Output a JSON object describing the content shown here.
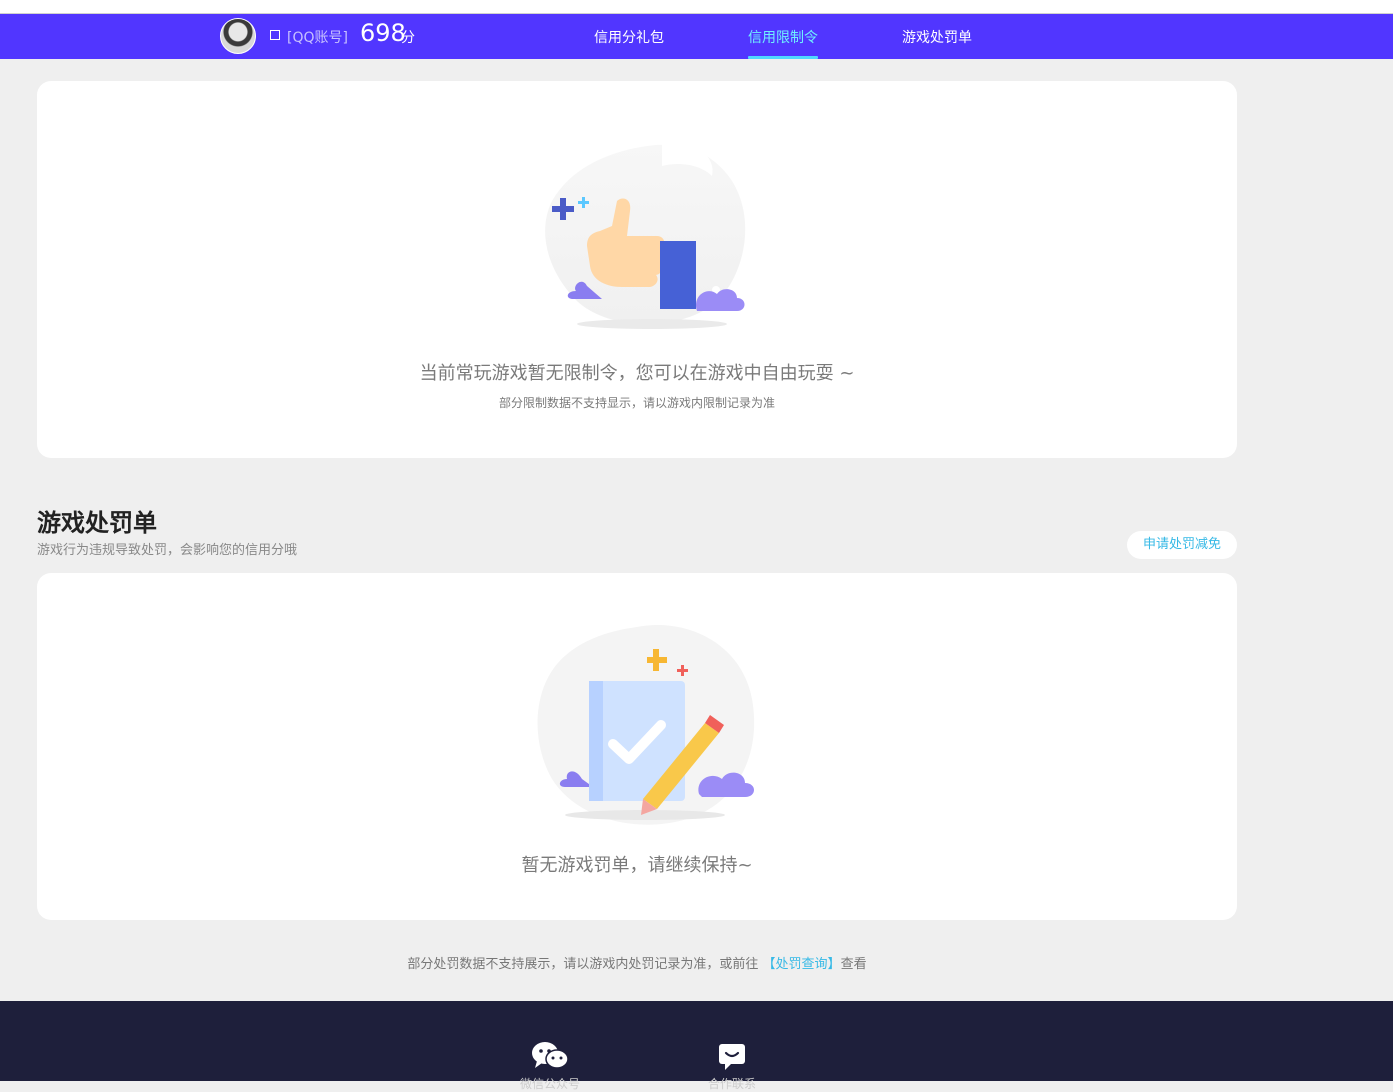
{
  "header": {
    "account_type": "[QQ账号]",
    "score": "698",
    "score_unit": "分",
    "tabs": [
      {
        "label": "信用分礼包",
        "active": false
      },
      {
        "label": "信用限制令",
        "active": true
      },
      {
        "label": "游戏处罚单",
        "active": false
      }
    ]
  },
  "restriction_section": {
    "empty_title": "当前常玩游戏暂无限制令，您可以在游戏中自由玩耍 ~",
    "empty_note": "部分限制数据不支持显示，请以游戏内限制记录为准"
  },
  "penalty_section": {
    "title": "游戏处罚单",
    "description": "游戏行为违规导致处罚，会影响您的信用分哦",
    "appeal_button": "申请处罚减免",
    "empty_title": "暂无游戏罚单，请继续保持~"
  },
  "footnote": {
    "text_before": "部分处罚数据不支持展示，请以游戏内处罚记录为准，或前往 ",
    "link_text": "【处罚查询】",
    "text_after": "查看"
  },
  "footer": {
    "items": [
      {
        "label": "微信公众号",
        "icon": "wechat-icon"
      },
      {
        "label": "合作联系",
        "icon": "message-icon"
      }
    ]
  },
  "colors": {
    "nav_bg": "#5136ff",
    "active_tab": "#6ff0ff",
    "link": "#36b9e6",
    "footer_bg": "#1e1f3b"
  }
}
